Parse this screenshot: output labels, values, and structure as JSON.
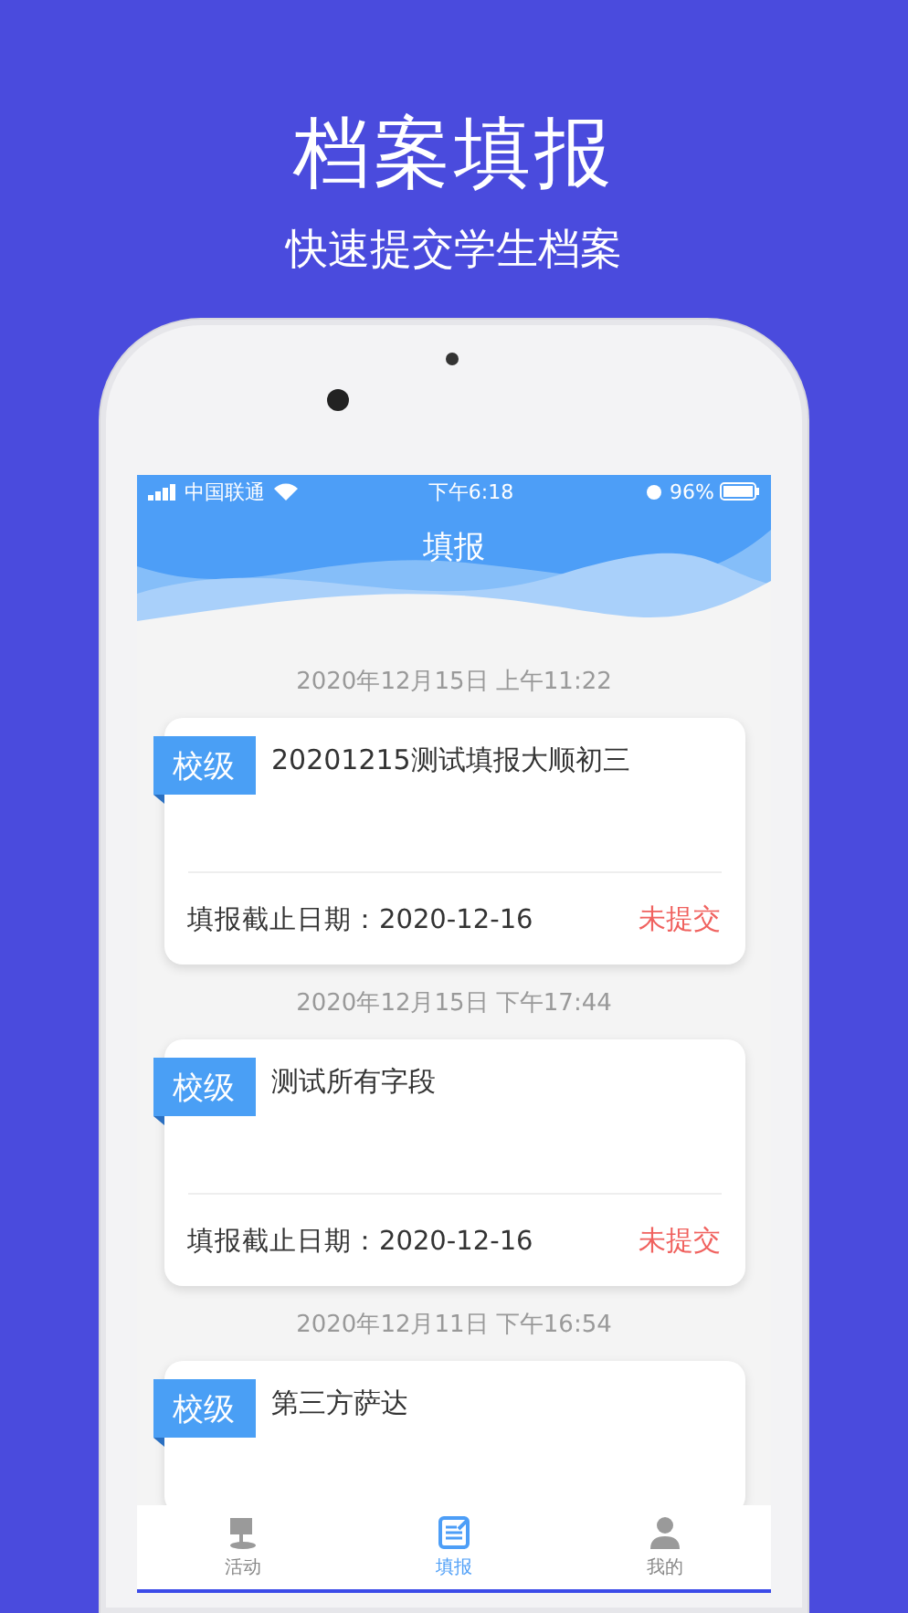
{
  "promo": {
    "headline": "档案填报",
    "subtitle": "快速提交学生档案"
  },
  "status_bar": {
    "carrier": "中国联通",
    "time": "下午6:18",
    "battery": "96%"
  },
  "header": {
    "title": "填报"
  },
  "entries": [
    {
      "date": "2020年12月15日 上午11:22",
      "tag": "校级",
      "title": "20201215测试填报大顺初三",
      "deadline": "填报截止日期：2020-12-16",
      "status": "未提交"
    },
    {
      "date": "2020年12月15日 下午17:44",
      "tag": "校级",
      "title": "测试所有字段",
      "deadline": "填报截止日期：2020-12-16",
      "status": "未提交"
    },
    {
      "date": "2020年12月11日 下午16:54",
      "tag": "校级",
      "title": "第三方萨达"
    }
  ],
  "tab_bar": [
    {
      "kind": "activity",
      "label": "活动",
      "selected": false
    },
    {
      "kind": "form",
      "label": "填报",
      "selected": true
    },
    {
      "kind": "profile",
      "label": "我的",
      "selected": false
    }
  ]
}
